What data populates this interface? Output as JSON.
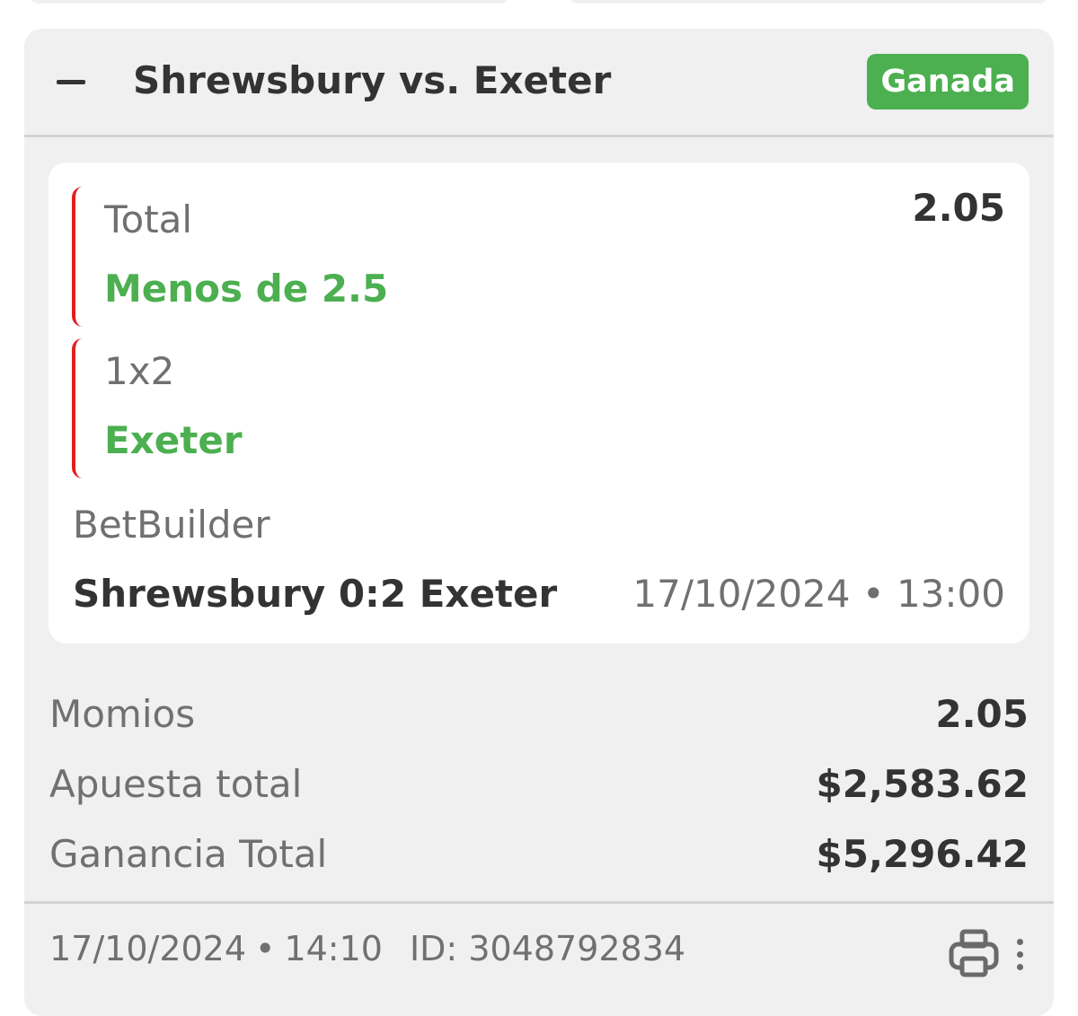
{
  "colors": {
    "card_background": "#f0f0f0",
    "inner_background": "#ffffff",
    "status_green": "#4caf50",
    "accent_red": "#e02020",
    "text_dark": "#333333",
    "text_muted": "#707070"
  },
  "ticket": {
    "collapse_icon": "minus-icon",
    "title": "Shrewsbury vs. Exeter",
    "status": "Ganada",
    "selections": [
      {
        "market": "Total",
        "pick": "Menos de 2.5",
        "odds": "2.05"
      },
      {
        "market": "1x2",
        "pick": "Exeter"
      }
    ],
    "bet_type": "BetBuilder",
    "event_result": "Shrewsbury 0:2 Exeter",
    "event_datetime": "17/10/2024 • 13:00",
    "summary": {
      "odds_label": "Momios",
      "odds_value": "2.05",
      "stake_label": "Apuesta total",
      "stake_value": "$2,583.62",
      "winnings_label": "Ganancia Total",
      "winnings_value": "$5,296.42"
    },
    "footer": {
      "placed_date": "17/10/2024",
      "separator": "•",
      "placed_time": "14:10",
      "bet_id": "ID: 3048792834",
      "print_icon": "printer-icon",
      "more_icon": "more-vertical-icon"
    }
  }
}
